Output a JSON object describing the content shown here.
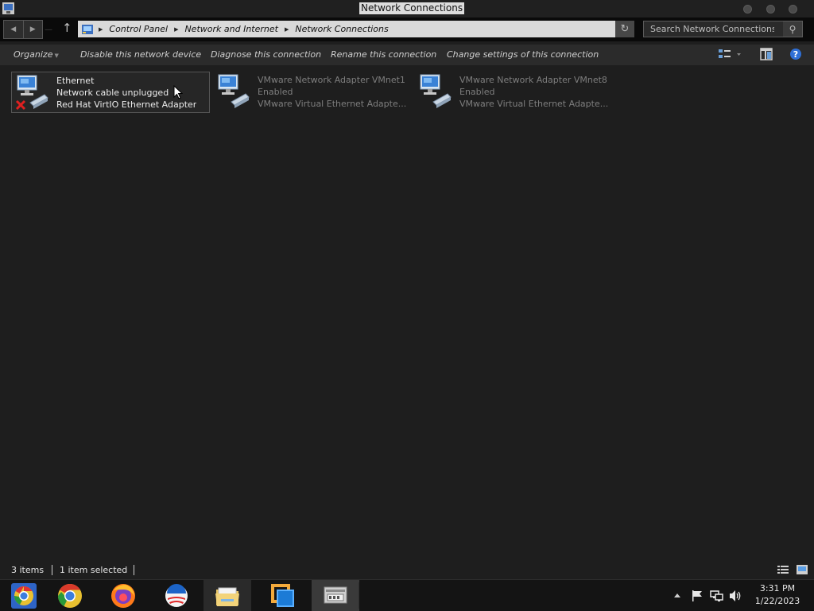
{
  "window": {
    "title": "Network Connections"
  },
  "address_bar": {
    "crumbs": [
      "Control Panel",
      "Network and Internet",
      "Network Connections"
    ]
  },
  "search": {
    "placeholder": "Search Network Connections"
  },
  "toolbar": {
    "organize": "Organize",
    "disable": "Disable this network device",
    "diagnose": "Diagnose this connection",
    "rename": "Rename this connection",
    "change_settings": "Change settings of this connection"
  },
  "connections": [
    {
      "name": "Ethernet",
      "status": "Network cable unplugged",
      "device": "Red Hat VirtIO Ethernet Adapter",
      "selected": true,
      "disconnected": true
    },
    {
      "name": "VMware Network Adapter VMnet1",
      "status": "Enabled",
      "device": "VMware Virtual Ethernet Adapte...",
      "selected": false,
      "disconnected": false
    },
    {
      "name": "VMware Network Adapter VMnet8",
      "status": "Enabled",
      "device": "VMware Virtual Ethernet Adapte...",
      "selected": false,
      "disconnected": false
    }
  ],
  "status": {
    "items": "3 items",
    "selected": "1 item selected"
  },
  "taskbar": {
    "apps": [
      "chromium-icon",
      "chrome-icon",
      "firefox-icon",
      "obama-logo-icon",
      "file-explorer-icon",
      "vmware-icon",
      "network-connections-icon"
    ]
  },
  "clock": {
    "time": "3:31 PM",
    "date": "1/22/2023"
  },
  "colors": {
    "background": "#1e1e1e",
    "address_bar": "#d9d9d9",
    "taskbar": "#141414"
  }
}
